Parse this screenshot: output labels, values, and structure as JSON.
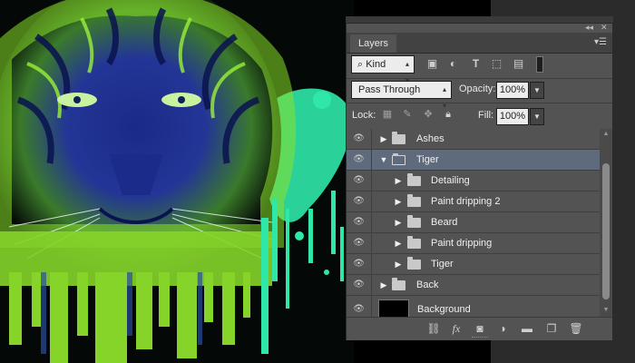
{
  "panel": {
    "tab_label": "Layers",
    "kind_label": "Kind",
    "blend_mode": "Pass Through",
    "opacity_label": "Opacity:",
    "opacity_value": "100%",
    "lock_label": "Lock:",
    "fill_label": "Fill:",
    "fill_value": "100%"
  },
  "layers": [
    {
      "name": "Ashes",
      "type": "group",
      "expanded": false,
      "indent": 0,
      "selected": false
    },
    {
      "name": "Tiger",
      "type": "group",
      "expanded": true,
      "indent": 0,
      "selected": true
    },
    {
      "name": "Detailing",
      "type": "group",
      "expanded": false,
      "indent": 1,
      "selected": false
    },
    {
      "name": "Paint dripping 2",
      "type": "group",
      "expanded": false,
      "indent": 1,
      "selected": false
    },
    {
      "name": "Beard",
      "type": "group",
      "expanded": false,
      "indent": 1,
      "selected": false
    },
    {
      "name": "Paint dripping",
      "type": "group",
      "expanded": false,
      "indent": 1,
      "selected": false
    },
    {
      "name": "Tiger",
      "type": "group",
      "expanded": false,
      "indent": 1,
      "selected": false
    },
    {
      "name": "Back",
      "type": "group",
      "expanded": false,
      "indent": 0,
      "selected": false
    },
    {
      "name": "Background",
      "type": "pixel",
      "expanded": false,
      "indent": 0,
      "selected": false
    }
  ],
  "colors": {
    "panel_bg": "#535353",
    "selected_row": "#5f6b7d",
    "tiger_green": "#8be22a",
    "tiger_blue": "#1c2b8c",
    "mint_splash": "#2fe8a8"
  },
  "icons": {
    "filter": [
      "image-filter-icon",
      "adjustment-filter-icon",
      "type-filter-icon",
      "shape-filter-icon",
      "smart-object-filter-icon"
    ],
    "lock": [
      "lock-transparent-icon",
      "lock-image-icon",
      "lock-position-icon",
      "lock-all-icon"
    ],
    "bottom": [
      "link-icon",
      "fx-icon",
      "mask-icon",
      "adjustment-icon",
      "new-group-icon",
      "new-layer-icon",
      "trash-icon"
    ]
  }
}
